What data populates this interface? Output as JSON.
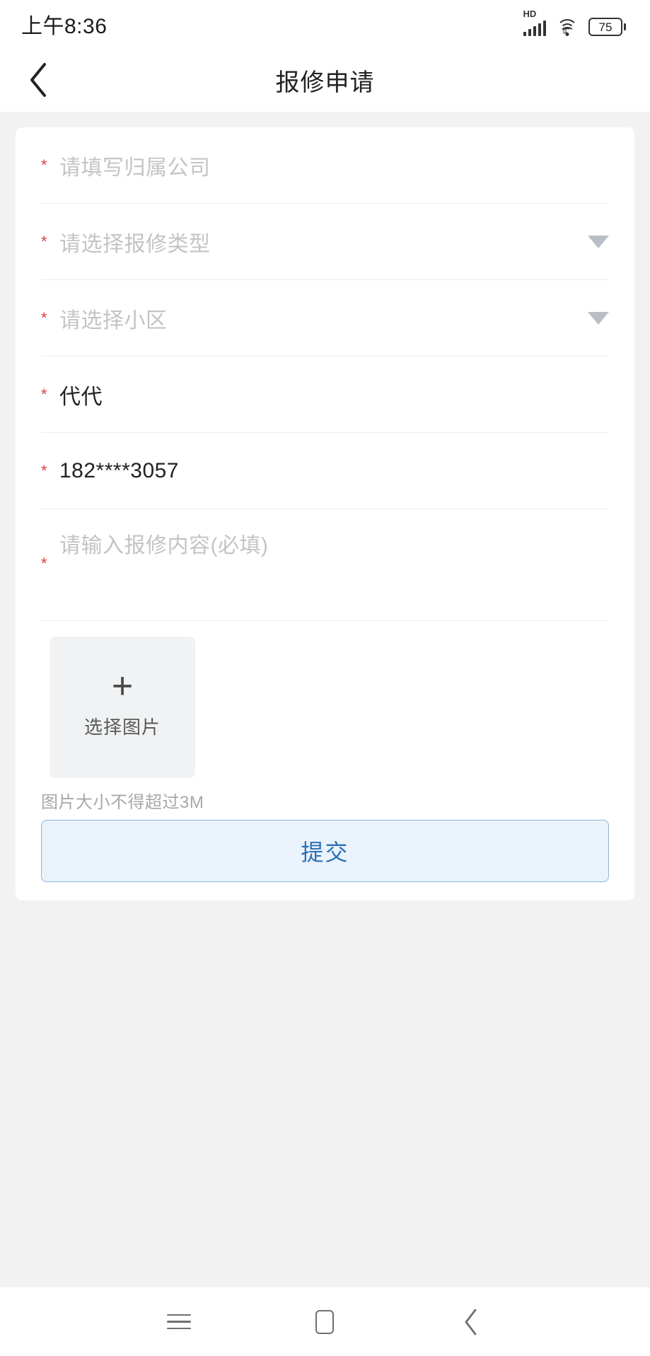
{
  "statusbar": {
    "time": "上午8:36",
    "network_label": "HD",
    "battery_level": "75",
    "signal_icon": "signal-bars-icon",
    "wifi_icon": "wifi-icon",
    "battery_icon": "battery-icon"
  },
  "header": {
    "title": "报修申请",
    "back_icon": "back-chevron-icon"
  },
  "form": {
    "fields": [
      {
        "required_mark": "*",
        "value": "请填写归属公司",
        "filled": false,
        "type": "text"
      },
      {
        "required_mark": "*",
        "value": "请选择报修类型",
        "filled": false,
        "type": "select"
      },
      {
        "required_mark": "*",
        "value": "请选择小区",
        "filled": false,
        "type": "select"
      },
      {
        "required_mark": "*",
        "value": "代代",
        "filled": true,
        "type": "text"
      },
      {
        "required_mark": "*",
        "value": "182****3057",
        "filled": true,
        "type": "text"
      }
    ],
    "content_field": {
      "required_mark": "*",
      "placeholder": "请输入报修内容(必填)"
    },
    "upload": {
      "plus_icon": "plus-icon",
      "label": "选择图片",
      "hint": "图片大小不得超过3M"
    },
    "submit_label": "提交"
  },
  "androidnav": {
    "recents_icon": "recents-menu-icon",
    "home_icon": "home-square-icon",
    "back_icon": "back-chevron-icon"
  },
  "colors": {
    "accent": "#2c6fb5",
    "required": "#e04040",
    "page_bg": "#f2f2f2",
    "submit_bg": "#eaf2fb",
    "submit_border": "#8fb6d8"
  }
}
